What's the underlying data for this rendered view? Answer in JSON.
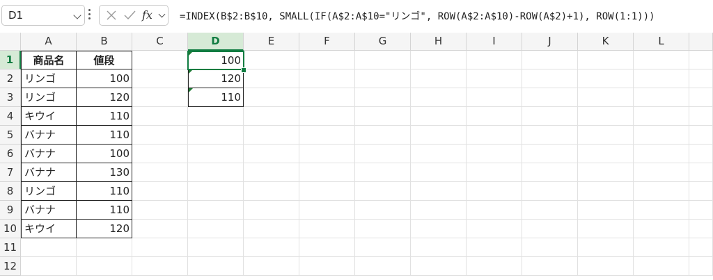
{
  "name_box": {
    "value": "D1"
  },
  "formula_bar": {
    "formula": "=INDEX(B$2:B$10, SMALL(IF(A$2:A$10=\"リンゴ\", ROW(A$2:A$10)-ROW(A$2)+1), ROW(1:1)))",
    "icons": [
      "cancel-icon",
      "check-icon",
      "fx-icon"
    ]
  },
  "columns": [
    "A",
    "B",
    "C",
    "D",
    "E",
    "F",
    "G",
    "H",
    "I",
    "J",
    "K",
    "L"
  ],
  "rows": [
    "1",
    "2",
    "3",
    "4",
    "5",
    "6",
    "7",
    "8",
    "9",
    "10",
    "11",
    "12"
  ],
  "table": {
    "headers": [
      "商品名",
      "値段"
    ],
    "rows": [
      [
        "リンゴ",
        "100"
      ],
      [
        "リンゴ",
        "120"
      ],
      [
        "キウイ",
        "110"
      ],
      [
        "バナナ",
        "110"
      ],
      [
        "バナナ",
        "100"
      ],
      [
        "バナナ",
        "130"
      ],
      [
        "リンゴ",
        "110"
      ],
      [
        "バナナ",
        "110"
      ],
      [
        "キウイ",
        "120"
      ]
    ]
  },
  "results": [
    "100",
    "120",
    "110"
  ],
  "colors": {
    "accent": "#107c41",
    "error_triangle": "#1e7b34"
  }
}
